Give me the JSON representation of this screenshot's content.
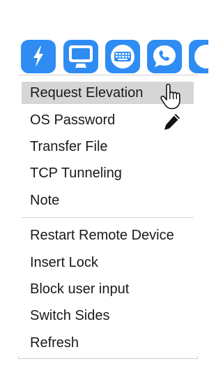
{
  "toolbar": {
    "buttons": [
      {
        "icon": "lightning-icon",
        "color": "#2f8cf2"
      },
      {
        "icon": "monitor-icon",
        "color": "#2f8cf2"
      },
      {
        "icon": "keyboard-icon",
        "color": "#2f8cf2"
      },
      {
        "icon": "chat-phone-icon",
        "color": "#2f8cf2"
      },
      {
        "icon": "more-icon",
        "color": "#2f8cf2"
      }
    ]
  },
  "menu": {
    "group1": [
      {
        "label": "Request Elevation",
        "highlighted": true
      },
      {
        "label": "OS Password"
      },
      {
        "label": "Transfer File"
      },
      {
        "label": "TCP Tunneling"
      },
      {
        "label": "Note"
      }
    ],
    "group2": [
      {
        "label": "Restart Remote Device"
      },
      {
        "label": "Insert Lock"
      },
      {
        "label": "Block user input"
      },
      {
        "label": "Switch Sides"
      },
      {
        "label": "Refresh"
      }
    ]
  },
  "colors": {
    "accent": "#2f8cf2",
    "hover": "#d6d6d6",
    "text": "#1a1a1a"
  },
  "cursor": {
    "icon": "hand-pointer-icon"
  },
  "pencil": {
    "icon": "pencil-icon"
  }
}
